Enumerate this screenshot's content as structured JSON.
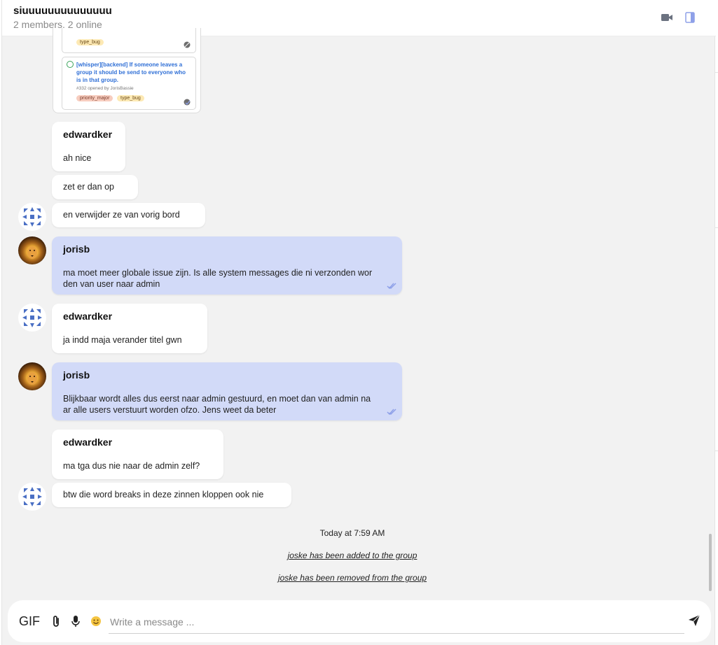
{
  "header": {
    "title": "siuuuuuuuuuuuuuu",
    "subtitle": "2 members, 2 online",
    "icons": [
      "video-camera-icon",
      "side-panel-icon"
    ]
  },
  "embed": {
    "card1_labels": [
      "type_bug"
    ],
    "card2": {
      "title": "[whisper][backend] If someone leaves a group it should be send to everyone who is in that group.",
      "meta": "#332 opened by JorisBassie",
      "labels": [
        "priority_major",
        "type_bug"
      ]
    }
  },
  "messages": [
    {
      "author": "edwardker",
      "text": "ah nice"
    },
    {
      "author": "",
      "text": "zet er dan op"
    },
    {
      "author": "",
      "text": "en verwijder ze van vorig bord"
    },
    {
      "author": "jorisb",
      "text": "ma moet meer globale issue zijn. Is alle system messages die ni verzonden wor",
      "text2": "den van user naar admin"
    },
    {
      "author": "edwardker",
      "text": "ja indd maja verander titel gwn"
    },
    {
      "author": "jorisb",
      "text": "Blijkbaar wordt alles dus eerst naar admin gestuurd, en moet dan van admin na",
      "text2": "ar alle users verstuurt worden ofzo. Jens weet da beter"
    },
    {
      "author": "edwardker",
      "text": "ma tga dus nie naar de admin zelf?"
    },
    {
      "author": "",
      "text": "btw die word breaks in deze zinnen kloppen ook nie"
    }
  ],
  "date_separator": "Today at 7:59 AM",
  "system_messages": [
    "joske has been added to the group",
    "joske has been removed from the group"
  ],
  "composer": {
    "gif_label": "GIF",
    "placeholder": "Write a message ...",
    "icons": [
      "paperclip-icon",
      "microphone-icon",
      "emoji-icon",
      "send-icon"
    ]
  },
  "colors": {
    "own_bubble": "#d2daf8",
    "other_bubble": "#ffffff",
    "background": "#f2f2f2",
    "link": "#2f6fd6"
  }
}
